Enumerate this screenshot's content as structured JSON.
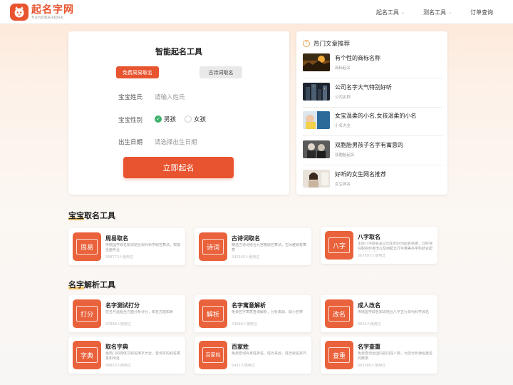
{
  "header": {
    "logo_title": "起名字网",
    "logo_sub": "专业为您和孩子起好名",
    "nav": [
      {
        "label": "起名工具",
        "dropdown": true
      },
      {
        "label": "测名工具",
        "dropdown": true
      },
      {
        "label": "订单查询",
        "dropdown": false
      }
    ]
  },
  "form": {
    "title": "智能起名工具",
    "tab_active": "免费周易取名",
    "tab_inactive": "古诗词取名",
    "surname_label": "宝宝姓氏",
    "surname_placeholder": "请输入姓氏",
    "gender_label": "宝宝性别",
    "gender_male": "男孩",
    "gender_female": "女孩",
    "birth_label": "出生日期",
    "birth_placeholder": "请选择出生日期",
    "submit": "立即起名"
  },
  "articles": {
    "heading": "热门文章推荐",
    "items": [
      {
        "title": "有个性的商标名称",
        "tag": "商标起名"
      },
      {
        "title": "公司名字大气特别好听",
        "tag": "公司名称"
      },
      {
        "title": "女宝温柔的小名,女孩温柔的小名",
        "tag": "小名大全"
      },
      {
        "title": "双胞胎男孩子名字有寓意的",
        "tag": "双胞胎起名"
      },
      {
        "title": "好听的女生网名推荐",
        "tag": "女生网名"
      }
    ]
  },
  "section1": {
    "title": "宝宝取名工具",
    "tools": [
      {
        "icon_text": "周易",
        "name": "周易取名",
        "desc": "传统国学取名知识结合现代科学取名算法，权威全面专业",
        "count": "568773人使用过"
      },
      {
        "icon_text": "诗词",
        "name": "古诗词取名",
        "desc": "精选古诗词结合九宫格取名算法，古风雅致有寓意",
        "count": "342345人使用过"
      },
      {
        "icon_text": "八字",
        "name": "八字取名",
        "desc": "生辰八字取名是以出生时间为起名依据，同时将在取名时考虑以及用起五行字寓等多学科结合起名的科学起名方法",
        "count": "567897人使用过"
      }
    ]
  },
  "section2": {
    "title": "名字解析工具",
    "tools": [
      {
        "icon_text": "打分",
        "name": "名字测试打分",
        "desc": "姓名与运程全方面分析评分，知名方能知命",
        "count": "67896人使用过"
      },
      {
        "icon_text": "解析",
        "name": "名字寓意解析",
        "desc": "免费名字寓意查询解析，分析来源、取小名等",
        "count": "23686人使用过"
      },
      {
        "icon_text": "改名",
        "name": "成人改名",
        "desc": "传统国学取名知识结合八字五行现代科学改名",
        "count": "6843人使用过"
      },
      {
        "icon_text": "字典",
        "name": "取名字典",
        "desc": "最热门的简体文取名用字大全，查询字的取名寓意和出处",
        "count": "84933人使用过"
      },
      {
        "icon_text": "百家姓",
        "name": "百家姓",
        "desc": "免费查询百家姓排名、姓氏来源、姓氏取名技巧",
        "count": "5431人使用过"
      },
      {
        "icon_text": "查重",
        "name": "名字查重",
        "desc": "免费查询全国同名同姓人数，为您分析通俗重名的概率",
        "count": "683389人使用过"
      }
    ]
  },
  "colors": {
    "accent": "#e8542f",
    "success": "#3cb16a",
    "highlight": "#f7c15a"
  }
}
